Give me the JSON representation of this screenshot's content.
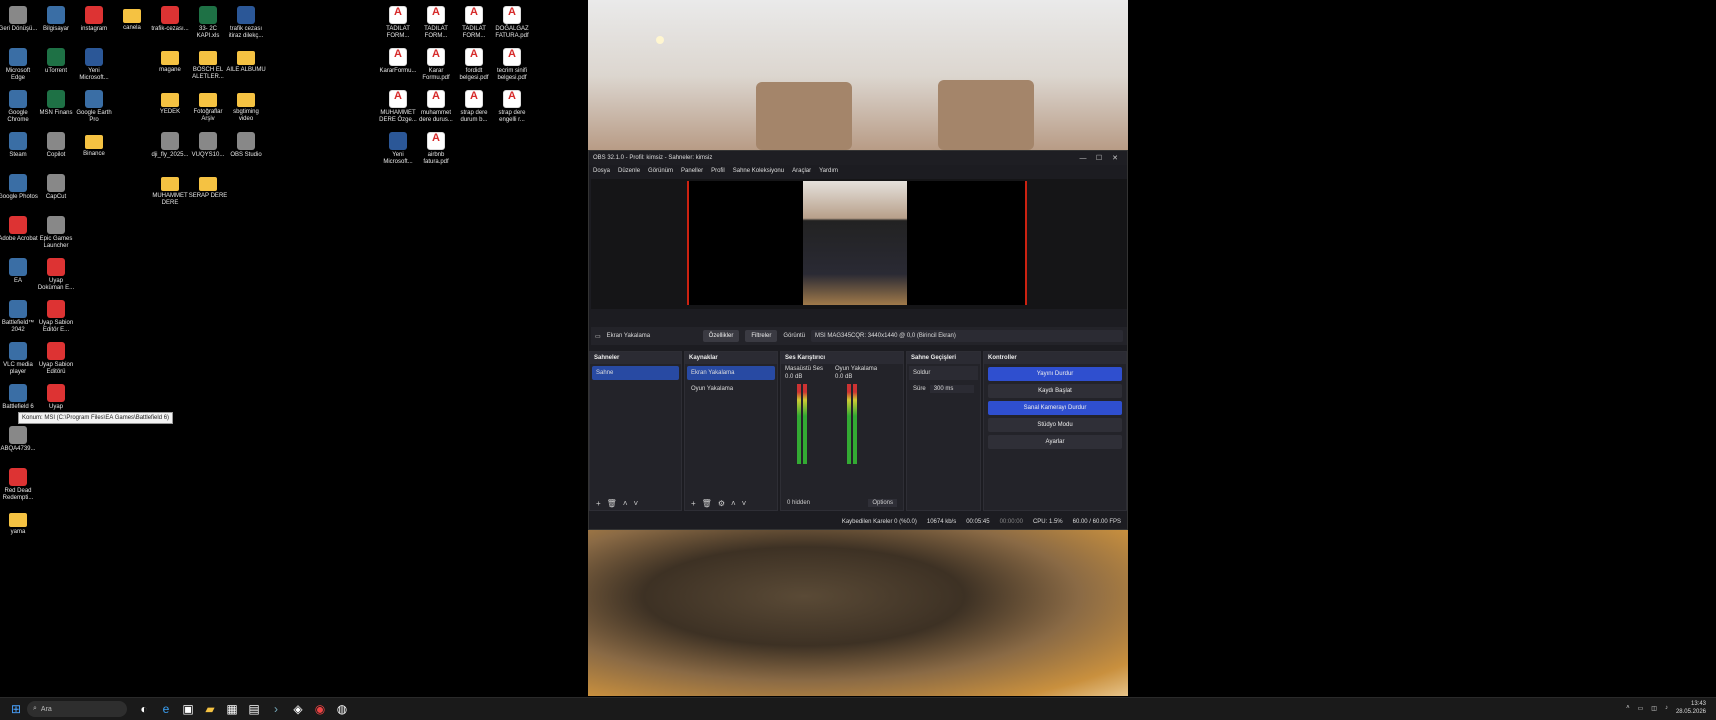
{
  "desktop": {
    "icons": [
      {
        "label": "Geri Dönüşü...",
        "type": "grey"
      },
      {
        "label": "Microsoft Edge",
        "type": "app"
      },
      {
        "label": "Google Chrome",
        "type": "app"
      },
      {
        "label": "Steam",
        "type": "app"
      },
      {
        "label": "Google Photos",
        "type": "app"
      },
      {
        "label": "Adobe Acrobat",
        "type": "red"
      },
      {
        "label": "EA",
        "type": "app"
      },
      {
        "label": "Battlefield™ 2042",
        "type": "app"
      },
      {
        "label": "VLC media player",
        "type": "app"
      },
      {
        "label": "Battlefield 6",
        "type": "app"
      },
      {
        "label": "ABQA4739...",
        "type": "grey"
      },
      {
        "label": "Red Dead Redempti...",
        "type": "red"
      },
      {
        "label": "yama",
        "type": "fold"
      },
      {
        "label": "Bilgisayar",
        "type": "app"
      },
      {
        "label": "uTorrent",
        "type": "xl"
      },
      {
        "label": "MSN Finans",
        "type": "xl"
      },
      {
        "label": "Copilot",
        "type": "grey"
      },
      {
        "label": "CapCut",
        "type": "grey"
      },
      {
        "label": "Epic Games Launcher",
        "type": "grey"
      },
      {
        "label": "Uyap Doküman E...",
        "type": "red"
      },
      {
        "label": "Uyap Sabion Editör E...",
        "type": "red"
      },
      {
        "label": "Uyap Sabion Editörü",
        "type": "red"
      },
      {
        "label": "Uyap",
        "type": "red"
      },
      {
        "label": "instagram",
        "type": "red"
      },
      {
        "label": "Yeni Microsoft...",
        "type": "word"
      },
      {
        "label": "Google Earth Pro",
        "type": "app"
      },
      {
        "label": "Binance",
        "type": "fold"
      },
      {
        "label": "canela",
        "type": "fold"
      },
      {
        "label": "magane",
        "type": "fold"
      },
      {
        "label": "YEDEK",
        "type": "fold"
      },
      {
        "label": "dji_fly_2025...",
        "type": "grey"
      },
      {
        "label": "MUHAMMET DERE",
        "type": "fold"
      },
      {
        "label": "trafik-cezası...",
        "type": "red"
      },
      {
        "label": "BOSCH EL ALETLER...",
        "type": "fold"
      },
      {
        "label": "Fotoğraflar Arşiv",
        "type": "fold"
      },
      {
        "label": "VUQYS10...",
        "type": "grey"
      },
      {
        "label": "SERAP DERE",
        "type": "fold"
      },
      {
        "label": "33- 2C KAPI.xls",
        "type": "xl"
      },
      {
        "label": "AILE ALBUMU",
        "type": "fold"
      },
      {
        "label": "sbgtiming video",
        "type": "fold"
      },
      {
        "label": "OBS Studio",
        "type": "grey"
      },
      {
        "label": "trafik cezası itiraz dilekç...",
        "type": "word"
      },
      {
        "label": "TADILAT FORM...",
        "type": "pdf"
      },
      {
        "label": "KararFormu...",
        "type": "pdf"
      },
      {
        "label": "MUHAMMET DERE Özge...",
        "type": "pdf"
      },
      {
        "label": "Yeni Microsoft...",
        "type": "word"
      },
      {
        "label": "TADILAT FORM...",
        "type": "pdf"
      },
      {
        "label": "Karar Formu.pdf",
        "type": "pdf"
      },
      {
        "label": "muhammet dere durus...",
        "type": "pdf"
      },
      {
        "label": "airbnb fatura.pdf",
        "type": "pdf"
      },
      {
        "label": "TADILAT FORM...",
        "type": "pdf"
      },
      {
        "label": "fordidt belgesi.pdf",
        "type": "pdf"
      },
      {
        "label": "strap dere durum b...",
        "type": "pdf"
      },
      {
        "label": "DOĞALGAZ FATURA.pdf",
        "type": "pdf"
      },
      {
        "label": "tecrim sinifi belgesi.pdf",
        "type": "pdf"
      },
      {
        "label": "strap dere engelli r...",
        "type": "pdf"
      }
    ],
    "tooltip": "Konum: MSI (C:\\Program Files\\EA Games\\Battlefield 6)"
  },
  "obs": {
    "title": "OBS 32.1.0 - Profil: kimsiz - Sahneler: kimsiz",
    "menu": [
      "Dosya",
      "Düzenle",
      "Görünüm",
      "Paneller",
      "Profil",
      "Sahne Koleksiyonu",
      "Araçlar",
      "Yardım"
    ],
    "context": {
      "source_name": "Ekran Yakalama",
      "props_label": "Özellikler",
      "filters_label": "Filtreler",
      "display_label": "Görüntü",
      "display_value": "MSI MAG345CQR: 3440x1440 @ 0,0 (Birincil Ekran)"
    },
    "docks": {
      "scenes": {
        "title": "Sahneler",
        "items": [
          "Sahne"
        ]
      },
      "sources": {
        "title": "Kaynaklar",
        "items": [
          "Ekran Yakalama",
          "Oyun Yakalama"
        ]
      },
      "mixer": {
        "title": "Ses Karıştırıcı",
        "ch1": "Masaüstü Ses",
        "ch2": "Oyun Yakalama",
        "db1": "0.0 dB",
        "db2": "0.0 dB",
        "hidden": "0 hidden",
        "options": "Options"
      },
      "transitions": {
        "title": "Sahne Geçişleri",
        "type": "Soldur",
        "duration_label": "Süre",
        "duration": "300 ms"
      },
      "controls": {
        "title": "Kontroller",
        "stop_stream": "Yayını Durdur",
        "record": "Kaydı Başlat",
        "virtual_cam": "Sanal Kamerayı Durdur",
        "studio": "Stüdyo Modu",
        "settings": "Ayarlar"
      }
    },
    "status": {
      "dropped": "Kaybedilen Kareler 0 (%0.0)",
      "bitrate": "10674 kb/s",
      "stream_time": "00:05:45",
      "rec_time": "00:00:00",
      "cpu": "CPU: 1.5%",
      "fps": "60.00 / 60.00 FPS"
    }
  },
  "taskbar": {
    "search_placeholder": "Ara",
    "time": "13:43",
    "date": "28.05.2026"
  }
}
